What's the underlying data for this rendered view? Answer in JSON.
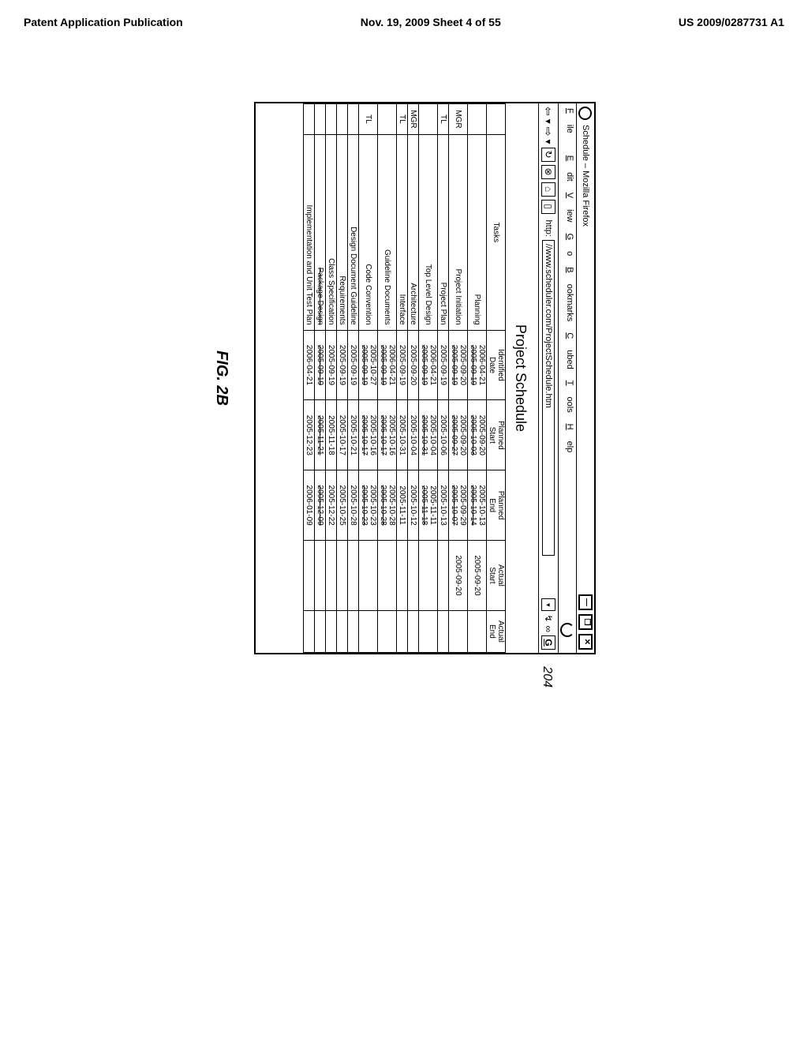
{
  "page_header": {
    "left": "Patent Application Publication",
    "center": "Nov. 19, 2009  Sheet 4 of 55",
    "right": "US 2009/0287731 A1"
  },
  "callout": "204",
  "figure_label": "FIG. 2B",
  "browser": {
    "title": "Schedule – Mozilla Firefox",
    "min": "—",
    "restore": "❐",
    "close": "✕",
    "menu": {
      "file": "File",
      "edit": "Edit",
      "view": "View",
      "go": "Go",
      "bookmarks": "Bookmarks",
      "cubed": "Cubed",
      "tools": "Tools",
      "help": "Help"
    },
    "url_label": "http:",
    "url": "//www.scheduler.com/ProjectSchedule.htm",
    "go_letter": "G",
    "page_title": "Project Schedule"
  },
  "table": {
    "headers": {
      "tasks": "Tasks",
      "identified": "Identified Date",
      "planned_start": "Planned Start",
      "planned_end": "Planned End",
      "actual_start": "Actual Start",
      "actual_end": "Actual End"
    },
    "rows": [
      {
        "role": "",
        "task": "Planning",
        "id1": "2006-04-21",
        "id2": "2005-09-19",
        "ps1": "2005-09-20",
        "ps2": "2005-10-03",
        "pe1": "2005-10-13",
        "pe2": "2005-10-14",
        "as": "2005-09-20",
        "ae": ""
      },
      {
        "role": "MGR",
        "task": "Project Initiation",
        "id1": "2005-09-20",
        "id2": "2005-09-19",
        "ps1": "2005-09-20",
        "ps2": "2005-09-27",
        "pe1": "2005-09-29",
        "pe2": "2005-10-07",
        "as": "2005-09-20",
        "ae": ""
      },
      {
        "role": "TL",
        "task": "Project Plan",
        "id1": "2005-09-19",
        "id2": "",
        "ps1": "2005-10-06",
        "ps2": "",
        "pe1": "2005-10-13",
        "pe2": "",
        "as": "",
        "ae": ""
      },
      {
        "role": "",
        "task": "Top Level Design",
        "id1": "2006-04-21",
        "id2": "2005-09-19",
        "ps1": "2005-10-04",
        "ps2": "2005-10-31",
        "pe1": "2005-11-11",
        "pe2": "2005-11-18",
        "as": "",
        "ae": ""
      },
      {
        "role": "MGR",
        "task": "Architecture",
        "id1": "2005-09-20",
        "id2": "",
        "ps1": "2005-10-04",
        "ps2": "",
        "pe1": "2005-10-12",
        "pe2": "",
        "as": "",
        "ae": ""
      },
      {
        "role": "TL",
        "task": "Interface",
        "id1": "2005-09-19",
        "id2": "",
        "ps1": "2005-10-31",
        "ps2": "",
        "pe1": "2005-11-11",
        "pe2": "",
        "as": "",
        "ae": ""
      },
      {
        "role": "",
        "task": "Guideline Documents",
        "id1": "2006-04-21",
        "id2": "2005-09-19",
        "ps1": "2005-10-16",
        "ps2": "2005-10-17",
        "pe1": "2005-10-28",
        "pe2": "2005-10-28",
        "as": "",
        "ae": ""
      },
      {
        "role": "TL",
        "task": "Code Convention",
        "id1": "2005-10-27",
        "id2": "2005-09-19",
        "ps1": "2005-10-16",
        "ps2": "2005-10-17",
        "pe1": "2005-10-23",
        "pe2": "2005-10-23",
        "as": "",
        "ae": ""
      },
      {
        "role": "",
        "task": "Design Document Guideline",
        "id1": "2005-09-19",
        "id2": "",
        "ps1": "2005-10-21",
        "ps2": "",
        "pe1": "2005-10-28",
        "pe2": "",
        "as": "",
        "ae": ""
      },
      {
        "role": "",
        "task": "Requirements",
        "id1": "2005-09-19",
        "id2": "",
        "ps1": "2005-10-17",
        "ps2": "",
        "pe1": "2005-10-25",
        "pe2": "",
        "as": "",
        "ae": ""
      },
      {
        "role": "",
        "task": "Class Specification",
        "id1": "2005-09-19",
        "id2": "",
        "ps1": "2005-11-18",
        "ps2": "",
        "pe1": "2005-12-22",
        "pe2": "",
        "as": "",
        "ae": ""
      },
      {
        "role": "",
        "task": "Package Design",
        "id1": "2005-09-19",
        "id2": "",
        "ps1": "2005-11-21",
        "ps2": "",
        "pe1": "2005-12-09",
        "pe2": "",
        "as": "",
        "ae": "",
        "task_strike": true,
        "id_strike": true,
        "ps_strike": true,
        "pe_strike": true
      },
      {
        "role": "",
        "task": "Implementation and Unit Test Plan",
        "id1": "2006-04-21",
        "id2": "",
        "ps1": "2005-12-23",
        "ps2": "",
        "pe1": "2006-01-09",
        "pe2": "",
        "as": "",
        "ae": ""
      }
    ]
  }
}
